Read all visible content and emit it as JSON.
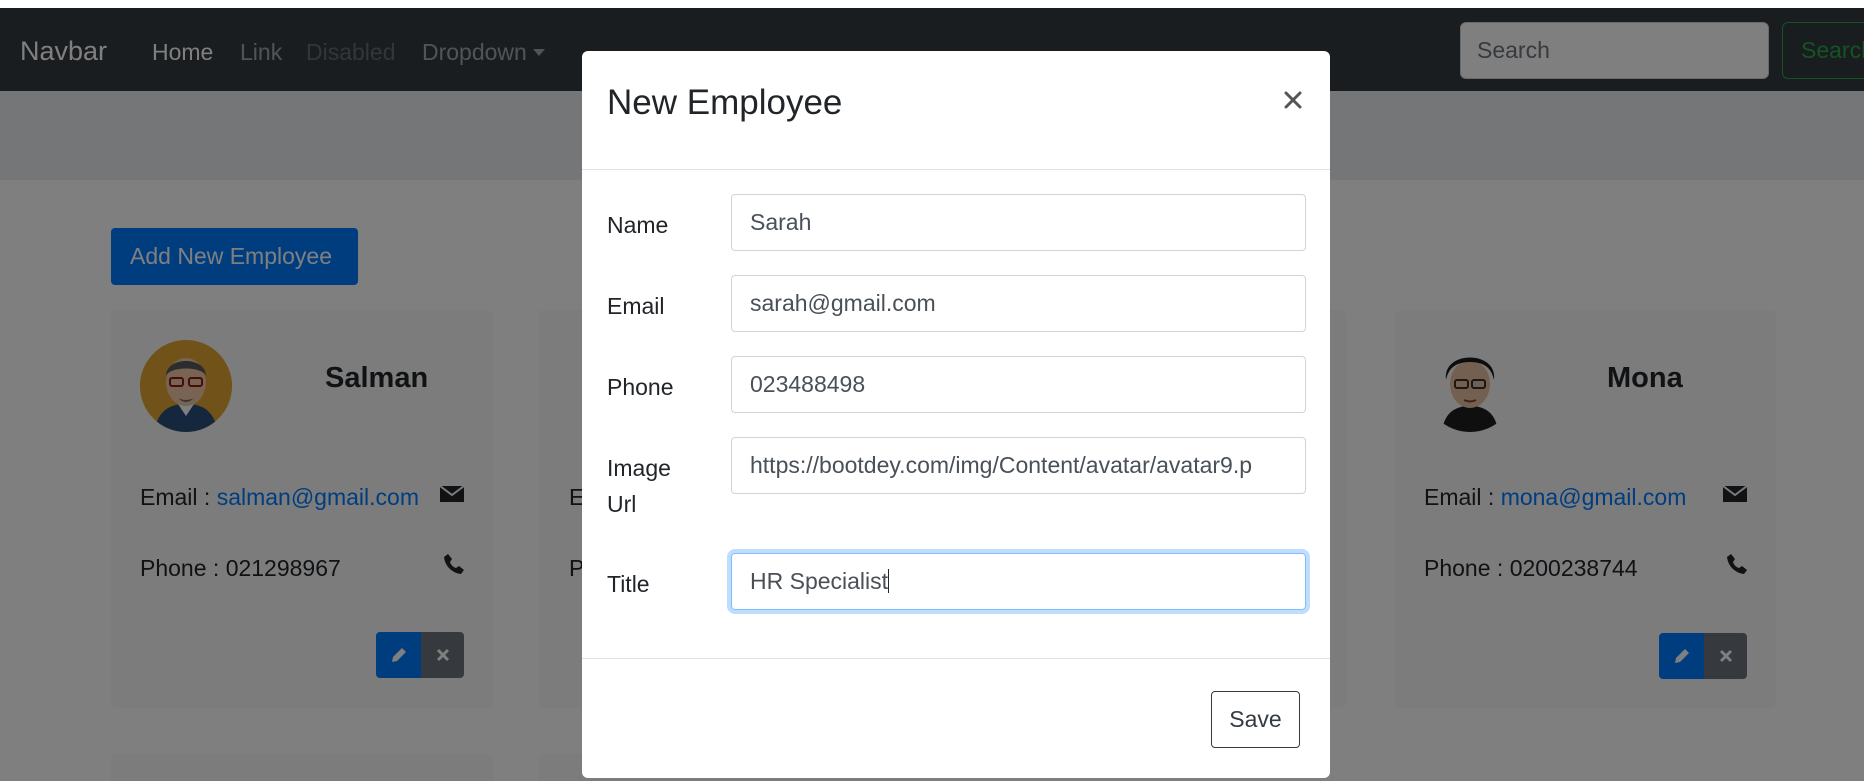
{
  "navbar": {
    "brand": "Navbar",
    "links": [
      {
        "label": "Home"
      },
      {
        "label": "Link"
      },
      {
        "label": "Disabled"
      },
      {
        "label": "Dropdown"
      }
    ],
    "search_placeholder": "Search",
    "search_button": "Search"
  },
  "main": {
    "add_button": "Add New Employee",
    "cards": [
      {
        "name": "Salman",
        "email_label": "Email : ",
        "email": "salman@gmail.com",
        "phone_label": "Phone : ",
        "phone": "021298967"
      },
      {
        "name": "",
        "email_label": "E",
        "email": "",
        "phone_label": "P",
        "phone": ""
      },
      {
        "name": "Mona",
        "email_label": "Email : ",
        "email": "mona@gmail.com",
        "phone_label": "Phone : ",
        "phone": "0200238744"
      }
    ]
  },
  "modal": {
    "title": "New Employee",
    "close_glyph": "×",
    "fields": [
      {
        "label": "Name",
        "value": "Sarah"
      },
      {
        "label": "Email",
        "value": "sarah@gmail.com"
      },
      {
        "label": "Phone",
        "value": "023488498"
      },
      {
        "label_line1": "Image",
        "label_line2": "Url",
        "value": "https://bootdey.com/img/Content/avatar/avatar9.p"
      },
      {
        "label": "Title",
        "value": "HR Specialist"
      }
    ],
    "save_button": "Save"
  },
  "colors": {
    "navbar_bg": "#343a40",
    "primary": "#007bff",
    "secondary": "#6c757d",
    "success": "#28a745",
    "focus_border": "#80bdff"
  }
}
